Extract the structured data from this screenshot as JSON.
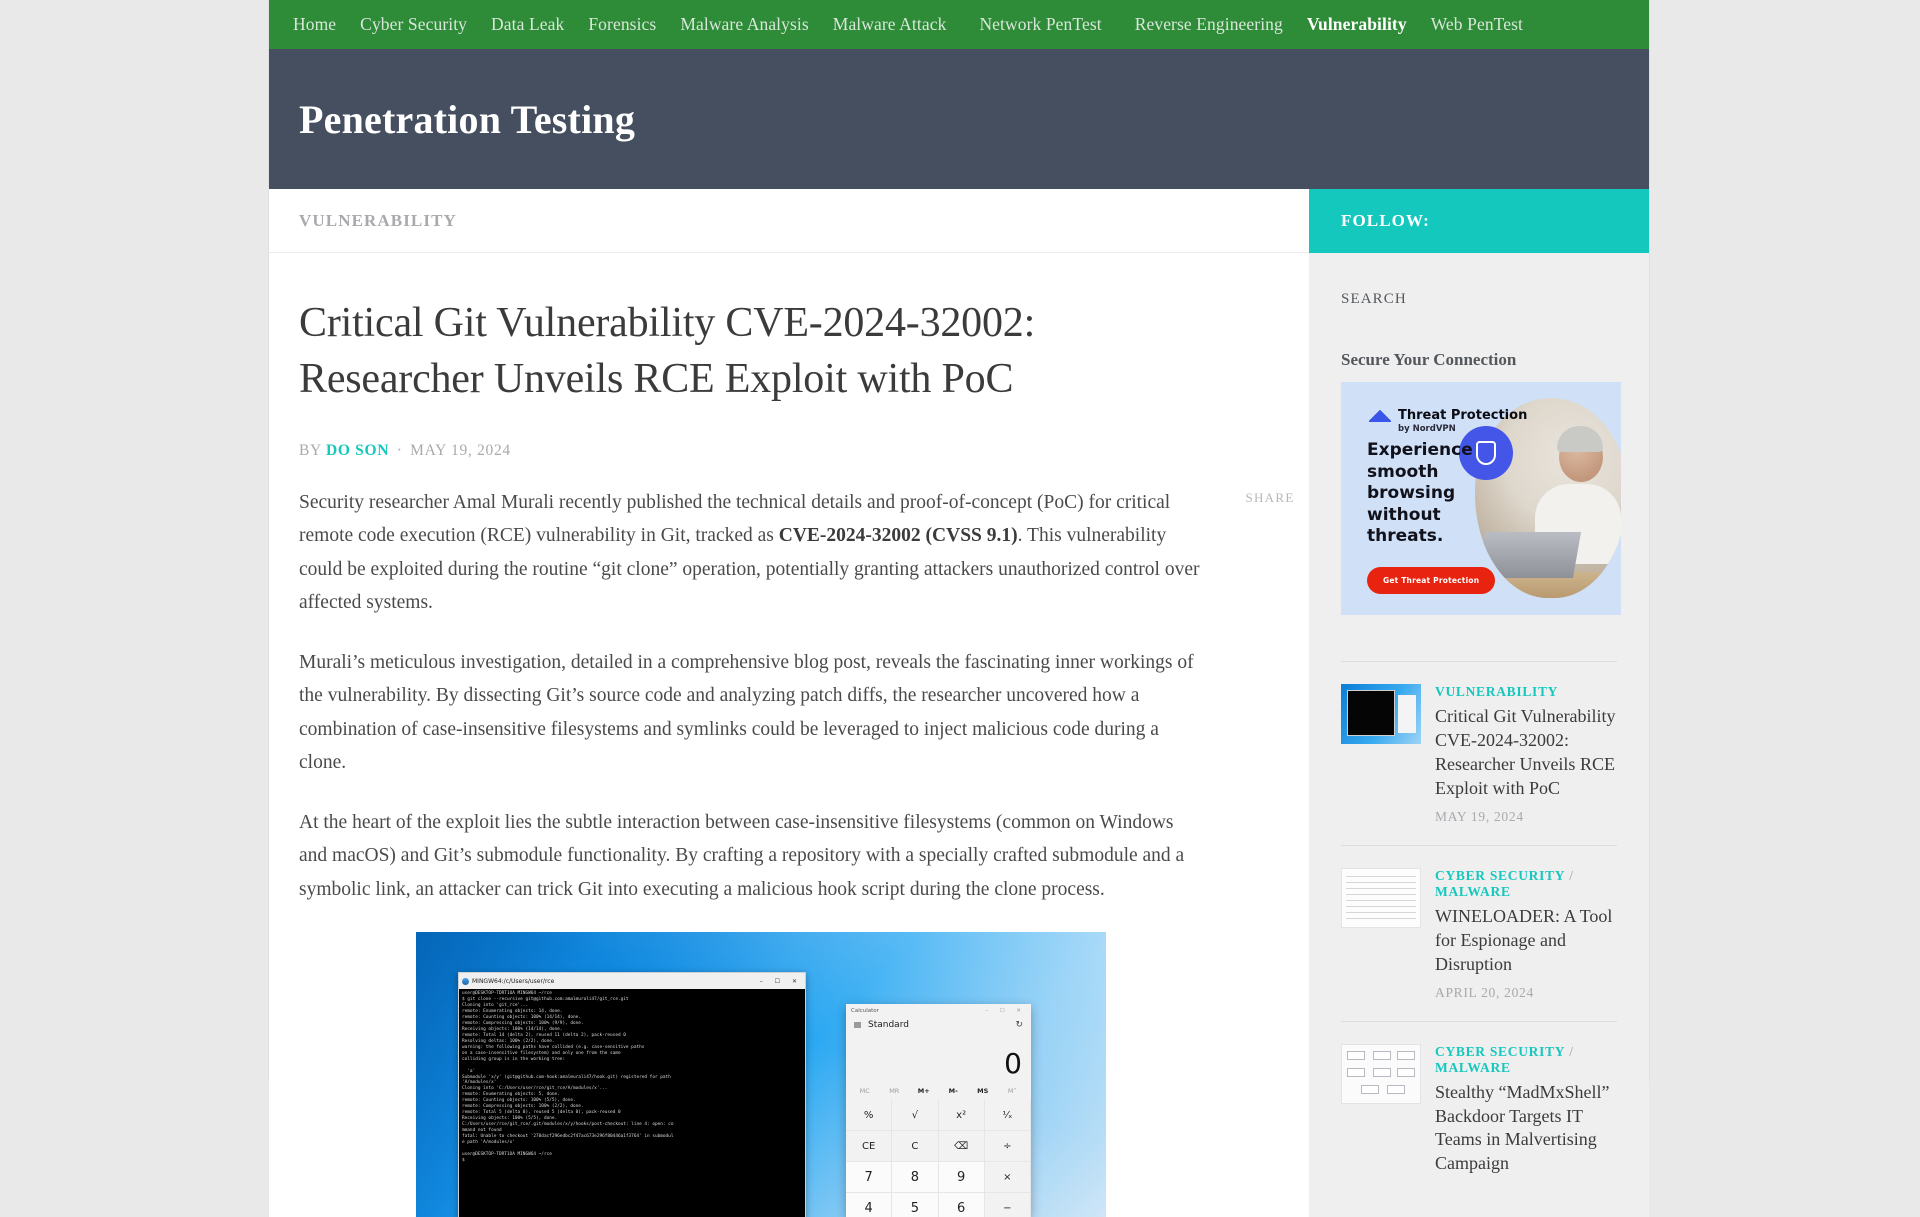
{
  "nav": {
    "items": [
      {
        "label": "Home",
        "active": false
      },
      {
        "label": "Cyber Security",
        "active": false
      },
      {
        "label": "Data Leak",
        "active": false
      },
      {
        "label": "Forensics",
        "active": false
      },
      {
        "label": "Malware Analysis",
        "active": false
      },
      {
        "label": "Malware Attack",
        "active": false
      },
      {
        "label": "Network PenTest",
        "active": false
      },
      {
        "label": "Reverse Engineering",
        "active": false
      },
      {
        "label": "Vulnerability",
        "active": true
      },
      {
        "label": "Web PenTest",
        "active": false
      }
    ]
  },
  "header": {
    "title": "Penetration Testing"
  },
  "breadcrumb": {
    "category": "VULNERABILITY"
  },
  "sidebar": {
    "follow_label": "FOLLOW:",
    "search_label": "SEARCH",
    "widget_title": "Secure Your Connection",
    "ad": {
      "brand": "Threat Protection",
      "brand_sup": "®",
      "byline": "by NordVPN",
      "headline": "Experience smooth browsing without threats.",
      "cta": "Get Threat Protection"
    },
    "posts": [
      {
        "category": "VULNERABILITY",
        "category2": "",
        "title": "Critical Git Vulnerability CVE-2024-32002: Researcher Unveils RCE Exploit with PoC",
        "date": "MAY 19, 2024"
      },
      {
        "category": "CYBER SECURITY",
        "category2": "MALWARE",
        "title": "WINELOADER: A Tool for Espionage and Disruption",
        "date": "APRIL 20, 2024"
      },
      {
        "category": "CYBER SECURITY",
        "category2": "MALWARE",
        "title": "Stealthy “MadMxShell” Backdoor Targets IT Teams in Malvertising Campaign",
        "date": ""
      }
    ]
  },
  "article": {
    "title": "Critical Git Vulnerability CVE-2024-32002: Researcher Unveils RCE Exploit with PoC",
    "by_label": "BY",
    "author": "DO SON",
    "separator": "·",
    "date": "MAY 19, 2024",
    "share_label": "SHARE",
    "para1_a": "Security researcher Amal Murali recently published the technical details and proof-of-concept (PoC) for critical remote code execution (RCE) vulnerability in Git, tracked as ",
    "para1_bold": "CVE-2024-32002 (CVSS 9.1)",
    "para1_b": ". This vulnerability could be exploited during the routine “git clone” operation, potentially granting attackers unauthorized control over affected systems.",
    "para2": "Murali’s meticulous investigation, detailed in a comprehensive blog post, reveals the fascinating inner workings of the vulnerability. By dissecting Git’s source code and analyzing patch diffs, the researcher uncovered how a combination of case-insensitive filesystems and symlinks could be leveraged to inject malicious code during a clone.",
    "para3": "At the heart of the exploit lies the subtle interaction between case-insensitive filesystems (common on Windows and macOS) and Git’s submodule functionality. By crafting a repository with a specially crafted submodule and a symbolic link, an attacker can trick Git into executing a malicious hook script during the clone process."
  },
  "screenshot": {
    "terminal": {
      "title": "MINGW64:/c/Users/user/rce",
      "min": "–",
      "max": "❐",
      "close": "✕",
      "lines": "user@DESKTOP-TDRT1OA MINGW64 ~/rce\n$ git clone --recursive git@github.com:amalmurali47/git_rce.git\nCloning into 'git_rce'...\nremote: Enumerating objects: 14, done.\nremote: Counting objects: 100% (14/14), done.\nremote: Compressing objects: 100% (9/9), done.\nReceiving objects: 100% (14/14), done.\nremote: Total 14 (delta 2), reused 11 (delta 2), pack-reused 0\nResolving deltas: 100% (2/2), done.\nwarning: the following paths have collided (e.g. case-sensitive paths\non a case-insensitive filesystem) and only one from the same\ncolliding group is in the working tree:\n\n  'a'\nSubmodule 'x/y' (git@github.com-hook:amalmurali47/hook.git) registered for path\n'A/modules/x'\nCloning into 'C:/Users/user/rce/git_rce/A/modules/x'...\nremote: Enumerating objects: 5, done.\nremote: Counting objects: 100% (5/5), done.\nremote: Compressing objects: 100% (2/2), done.\nremote: Total 5 (delta 0), reused 5 (delta 0), pack-reused 0\nReceiving objects: 100% (5/5), done.\nC:/Users/user/rce/git_rce/.git/modules/x/y/hooks/post-checkout: line 4: open: co\nmmand not found\nfatal: Unable to checkout '270dacf296edbc2f47ac673e296f80446a1f3764' in submodul\ne path 'A/modules/x'\n\nuser@DESKTOP-TDRT1OA MINGW64 ~/rce\n$"
    },
    "calculator": {
      "title": "Calculator",
      "mode": "Standard",
      "display": "0",
      "memory": [
        "MC",
        "MR",
        "M+",
        "M-",
        "MS",
        "M˅"
      ],
      "keys": [
        "%",
        "√",
        "x²",
        "⅟ₓ",
        "CE",
        "C",
        "⌫",
        "÷",
        "7",
        "8",
        "9",
        "×",
        "4",
        "5",
        "6",
        "−"
      ]
    }
  },
  "colors": {
    "nav_green": "#2e8b37",
    "hero_slate": "#454f5f",
    "accent_teal": "#15c8bd",
    "page_bg": "#e9e9e9"
  }
}
